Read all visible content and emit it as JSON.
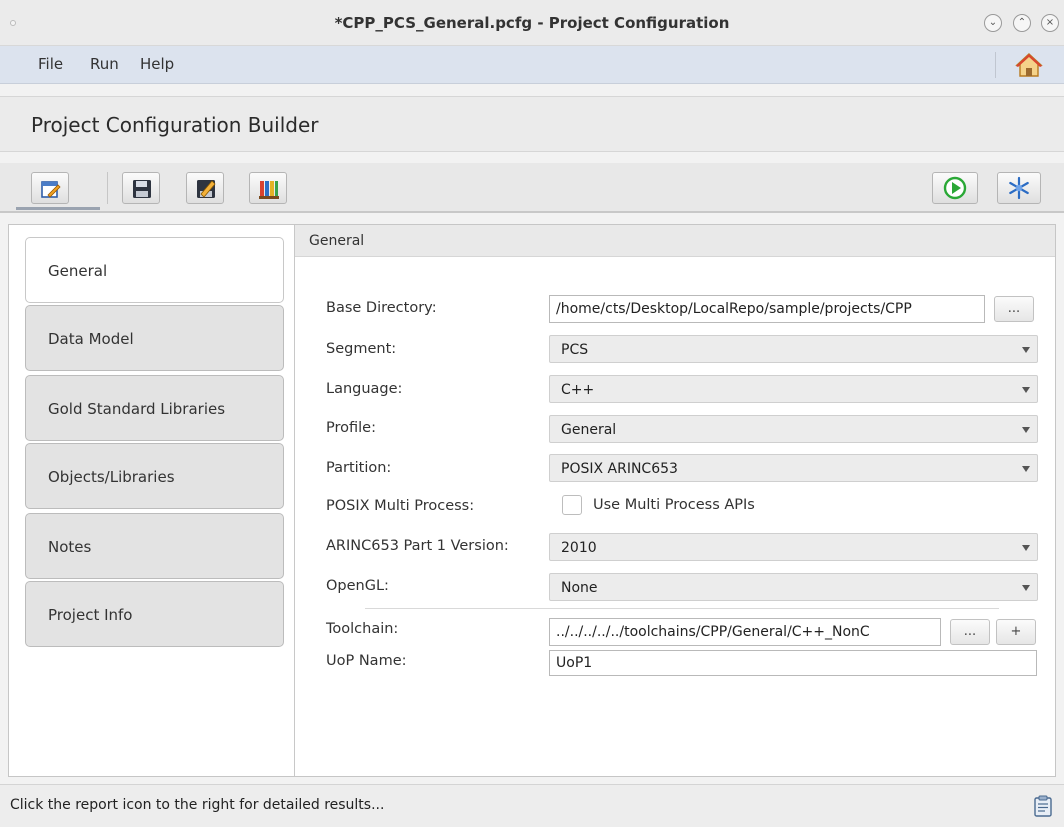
{
  "window": {
    "title": "*CPP_PCS_General.pcfg - Project Configuration",
    "controls": [
      "minimize",
      "maximize",
      "close"
    ]
  },
  "menubar": {
    "items": [
      "File",
      "Run",
      "Help"
    ],
    "home_icon": "home-icon"
  },
  "header": {
    "title": "Project Configuration Builder"
  },
  "toolbar": {
    "left_buttons": [
      "edit-config-icon",
      "save-icon",
      "save-as-icon",
      "library-books-icon"
    ],
    "right_buttons": [
      "run-icon",
      "settings-snowflake-icon"
    ]
  },
  "nav": {
    "selected": "General",
    "items": [
      {
        "label": "General"
      },
      {
        "label": "Data Model"
      },
      {
        "label": "Gold Standard Libraries"
      },
      {
        "label": "Objects/Libraries"
      },
      {
        "label": "Notes"
      },
      {
        "label": "Project Info"
      }
    ]
  },
  "panel": {
    "heading": "General",
    "base_directory": {
      "label": "Base Directory:",
      "value": "/home/cts/Desktop/LocalRepo/sample/projects/CPP",
      "browse_label": "..."
    },
    "segment": {
      "label": "Segment:",
      "value": "PCS"
    },
    "language": {
      "label": "Language:",
      "value": "C++"
    },
    "profile": {
      "label": "Profile:",
      "value": "General"
    },
    "partition": {
      "label": "Partition:",
      "value": "POSIX ARINC653"
    },
    "posix_multi_process": {
      "label": "POSIX Multi Process:",
      "checkbox_label": "Use Multi Process APIs",
      "checked": false
    },
    "arinc_version": {
      "label": "ARINC653 Part 1 Version:",
      "value": "2010"
    },
    "opengl": {
      "label": "OpenGL:",
      "value": "None"
    },
    "toolchain": {
      "label": "Toolchain:",
      "value": "../../../../../toolchains/CPP/General/C++_NonC",
      "browse_label": "...",
      "add_label": "+"
    },
    "uop_name": {
      "label": "UoP Name:",
      "value": "UoP1"
    }
  },
  "status": {
    "text": "Click the report icon to the right for detailed results...",
    "icon": "clipboard-report-icon"
  },
  "colors": {
    "menubar": "#dce3ee",
    "selected_tab": "#ffffff",
    "tab": "#e3e3e3",
    "run_green": "#2aa836",
    "snowflake_blue": "#2b6cc4"
  }
}
